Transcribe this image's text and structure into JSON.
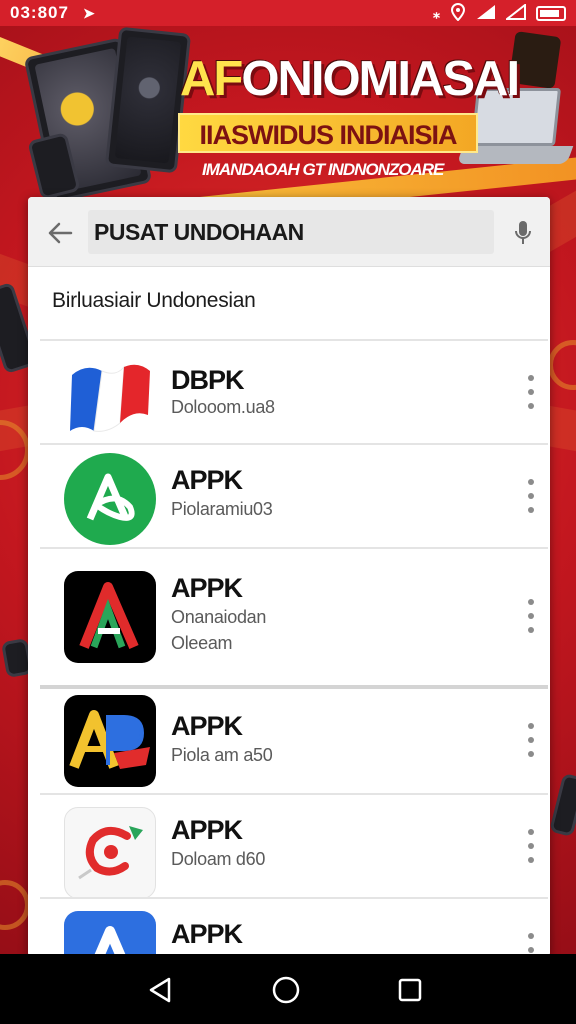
{
  "status_bar": {
    "time": "03:807",
    "icons": [
      "navigation-arrow-icon",
      "bluetooth-icon",
      "location-icon",
      "signal-icon",
      "signal-icon",
      "battery-icon"
    ]
  },
  "banner": {
    "headline_accent": "AF",
    "headline_rest": "ONIOMIASAI",
    "subline": "IIASWIDUS INDIAISIA",
    "tagline": "IMANDAOAH GT INDNONZOARE"
  },
  "search": {
    "query": "PUSAT UNDOHAAN",
    "back_icon": "back-arrow-icon",
    "mic_icon": "microphone-icon"
  },
  "section_label": "Birluasiair Undonesian",
  "apps": [
    {
      "title": "DBPK",
      "subtitle": "Dolooom.ua8",
      "subtitle2": "",
      "icon": "flag-ribbon-icon",
      "colors": [
        "#1f5fd6",
        "#e4262b",
        "#ffffff"
      ]
    },
    {
      "title": "APPK",
      "subtitle": "Piolaramiu03",
      "subtitle2": "",
      "icon": "green-a-logo-icon",
      "colors": [
        "#1faa4e",
        "#ffffff"
      ]
    },
    {
      "title": "APPK",
      "subtitle": "Onanaiodan",
      "subtitle2": "Oleeam",
      "icon": "striped-a-logo-icon",
      "colors": [
        "#000000",
        "#e02b2b",
        "#2aa55a"
      ]
    },
    {
      "title": "APPK",
      "subtitle": "Piola am a50",
      "subtitle2": "",
      "icon": "ap-logo-icon",
      "colors": [
        "#000000",
        "#f2c22e",
        "#2d6fe0",
        "#e12c2c"
      ]
    },
    {
      "title": "APPK",
      "subtitle": "Doloam d60",
      "subtitle2": "",
      "icon": "red-swirl-logo-icon",
      "colors": [
        "#ffffff",
        "#e12c2c"
      ]
    },
    {
      "title": "APPK",
      "subtitle": "",
      "subtitle2": "",
      "icon": "blue-a-logo-icon",
      "colors": [
        "#2d6fe0",
        "#f2c22e"
      ]
    }
  ],
  "nav_bar": {
    "buttons": [
      "back-triangle-icon",
      "home-circle-icon",
      "recents-square-icon"
    ]
  }
}
